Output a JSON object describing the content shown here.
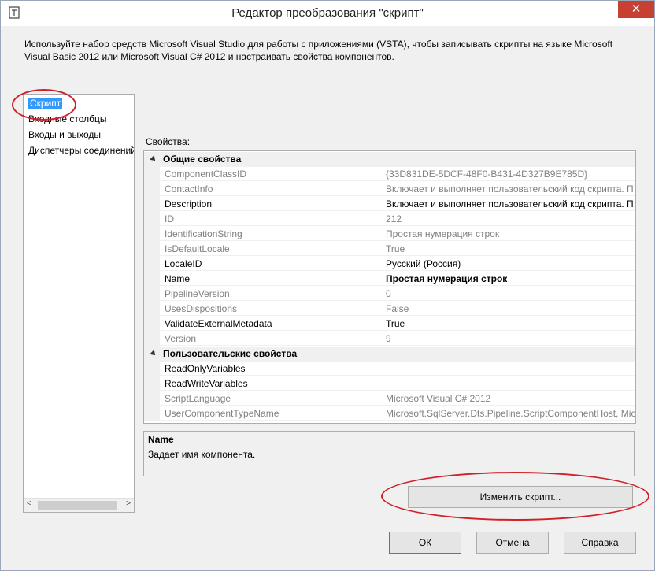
{
  "window": {
    "title": "Редактор преобразования \"скрипт\"",
    "close_glyph": "✕",
    "description": "Используйте набор средств Microsoft Visual Studio для работы с приложениями (VSTA), чтобы записывать скрипты на языке Microsoft Visual Basic 2012 или Microsoft Visual C# 2012 и настраивать свойства компонентов."
  },
  "nav": {
    "items": [
      {
        "label": "Скрипт",
        "selected": true
      },
      {
        "label": "Входные столбцы"
      },
      {
        "label": "Входы и выходы"
      },
      {
        "label": "Диспетчеры соединений"
      }
    ],
    "scroll_left": "<",
    "scroll_right": ">"
  },
  "properties": {
    "label": "Свойства:",
    "categories": [
      {
        "label": "Общие свойства"
      },
      {
        "label": "Пользовательские свойства"
      }
    ],
    "rows": [
      {
        "name": "ComponentClassID",
        "value": "{33D831DE-5DCF-48F0-B431-4D327B9E785D}"
      },
      {
        "name": "ContactInfo",
        "value": "Включает и выполняет пользовательский код скрипта. П"
      },
      {
        "name": "Description",
        "value": "Включает и выполняет пользовательский код скрипта. П"
      },
      {
        "name": "ID",
        "value": "212"
      },
      {
        "name": "IdentificationString",
        "value": "Простая нумерация строк"
      },
      {
        "name": "IsDefaultLocale",
        "value": "True"
      },
      {
        "name": "LocaleID",
        "value": "Русский (Россия)"
      },
      {
        "name": "Name",
        "value": "Простая нумерация строк"
      },
      {
        "name": "PipelineVersion",
        "value": "0"
      },
      {
        "name": "UsesDispositions",
        "value": "False"
      },
      {
        "name": "ValidateExternalMetadata",
        "value": "True"
      },
      {
        "name": "Version",
        "value": "9"
      },
      {
        "name": "ReadOnlyVariables",
        "value": ""
      },
      {
        "name": "ReadWriteVariables",
        "value": ""
      },
      {
        "name": "ScriptLanguage",
        "value": "Microsoft Visual C# 2012"
      },
      {
        "name": "UserComponentTypeName",
        "value": "Microsoft.SqlServer.Dts.Pipeline.ScriptComponentHost, Mic"
      }
    ]
  },
  "help_panel": {
    "title": "Name",
    "text": "Задает имя компонента."
  },
  "buttons": {
    "edit_script": "Изменить скрипт...",
    "ok": "ОК",
    "cancel": "Отмена",
    "help": "Справка"
  },
  "colors": {
    "selection": "#3399ff",
    "annotation": "#d0202a",
    "close_button": "#c84031"
  }
}
